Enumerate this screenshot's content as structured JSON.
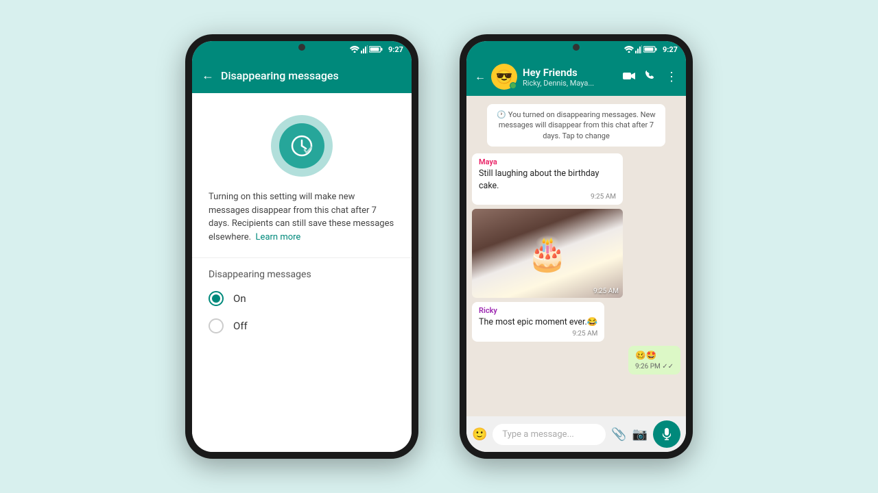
{
  "background": "#d8f0ee",
  "phone1": {
    "status_bar": {
      "time": "9:27"
    },
    "header": {
      "title": "Disappearing messages",
      "back_label": "←"
    },
    "description": "Turning on this setting will make new messages disappear from this chat after 7 days. Recipients can still save these messages elsewhere.",
    "learn_more": "Learn more",
    "options_label": "Disappearing messages",
    "radio_on": "On",
    "radio_off": "Off",
    "on_selected": true
  },
  "phone2": {
    "status_bar": {
      "time": "9:27"
    },
    "header": {
      "chat_name": "Hey Friends",
      "members": "Ricky, Dennis, Maya...",
      "back_label": "←"
    },
    "system_message": "You turned on disappearing messages. New messages will disappear from this chat after 7 days. Tap to change",
    "messages": [
      {
        "id": "msg1",
        "sender": "Maya",
        "sender_color": "maya",
        "text": "Still laughing about the birthday cake.",
        "time": "9:25 AM",
        "type": "text",
        "direction": "received"
      },
      {
        "id": "msg2",
        "sender": "Maya",
        "sender_color": "maya",
        "type": "image",
        "time": "9:25 AM",
        "direction": "received"
      },
      {
        "id": "msg3",
        "sender": "Ricky",
        "sender_color": "ricky",
        "text": "The most epic moment ever.😂",
        "time": "9:25 AM",
        "type": "text",
        "direction": "received"
      },
      {
        "id": "msg4",
        "sender": "",
        "text": "🥴🤩",
        "time": "9:26 PM ✓✓",
        "type": "text",
        "direction": "sent"
      }
    ],
    "input_placeholder": "Type a message..."
  }
}
